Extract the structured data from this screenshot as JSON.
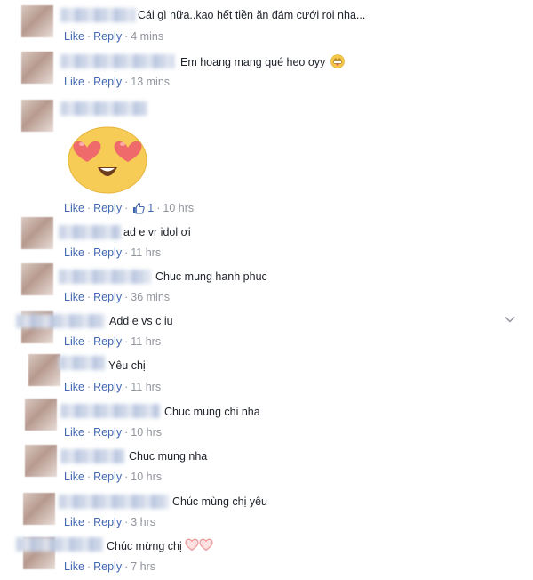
{
  "actions": {
    "like": "Like",
    "reply": "Reply",
    "separator": "·"
  },
  "colors": {
    "link": "#4267b2",
    "meta": "#90949c",
    "text": "#1d2129"
  },
  "comments": [
    {
      "text": "Cái gì nữa..kao hết tiền ăn đám cưới roi nha...",
      "time": "4 mins"
    },
    {
      "text": "Em hoang mang qué heo oyy",
      "emoji": "grinning-tongue-emoji",
      "time": "13 mins"
    },
    {
      "text": "",
      "sticker": "heart-eyes-sticker",
      "likes": "1",
      "time": "10 hrs"
    },
    {
      "text": "ad e vr idol ơi",
      "time": "11 hrs"
    },
    {
      "text": "Chuc mung hanh phuc",
      "time": "36 mins"
    },
    {
      "text": "Add e vs c iu",
      "time": "11 hrs"
    },
    {
      "text": "Yêu chị",
      "time": "11 hrs"
    },
    {
      "text": "Chuc mung chi nha",
      "time": "10 hrs"
    },
    {
      "text": "Chuc mung nha",
      "time": "10 hrs"
    },
    {
      "text": "Chúc mùng chị yêu",
      "time": "3 hrs"
    },
    {
      "text": "Chúc mừng chị",
      "emoji": "two-hearts-icon",
      "time": "7 hrs"
    }
  ]
}
